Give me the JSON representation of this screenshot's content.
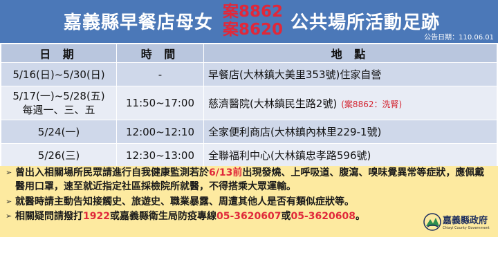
{
  "header": {
    "title_left": "嘉義縣早餐店母女",
    "case_1": "案8862",
    "case_2": "案8620",
    "title_right": "公共場所活動足跡",
    "announce_date": "公告日期：110.06.01"
  },
  "table": {
    "headers": [
      "日 期",
      "時 間",
      "地 點"
    ],
    "rows": [
      {
        "date": "5/16(日)~5/30(日)",
        "time": "-",
        "place": "早餐店(大林鎮大美里353號)住家自營",
        "note": ""
      },
      {
        "date": "5/17(一)~5/28(五)",
        "date_sub": "每週一、三、五",
        "time": "11:50~17:00",
        "place": "慈濟醫院(大林鎮民生路2號)",
        "note": "(案8862：洗腎)"
      },
      {
        "date": "5/24(一)",
        "time": "12:00~12:10",
        "place": "全家便利商店(大林鎮內林里229-1號)",
        "note": ""
      },
      {
        "date": "5/26(三)",
        "time": "12:30~13:00",
        "place": "全聯福利中心(大林鎮忠孝路596號)",
        "note": ""
      }
    ]
  },
  "notices": {
    "n1_a": "曾出入相關場所民眾請進行自我健康監測若於",
    "n1_red": "6/13前",
    "n1_b": "出現發燒、上呼吸道、腹瀉、嗅味覺異常等症狀，應佩戴醫用口罩，速至就近指定社區採檢院所就醫，不得搭乘大眾運輸。",
    "n2": "就醫時請主動告知接觸史、旅遊史、職業暴露、周遭其他人是否有類似症狀等。",
    "n3_a": "相關疑問請撥打",
    "n3_red1": "1922",
    "n3_b": "或嘉義縣衛生局防疫專線",
    "n3_red2": "05-3620607",
    "n3_c": "或",
    "n3_red3": "05-3620608",
    "n3_d": "。"
  },
  "logo": {
    "name": "嘉義縣政府",
    "sub": "Chiayi County Government"
  },
  "colors": {
    "header_bg": "#4b78b8",
    "case_red": "#e0283a",
    "table_header_bg": "#b9c6de",
    "row_dark": "#cfd8ea",
    "row_light": "#e8ecf5",
    "notice_bg": "#fdeaa0"
  }
}
